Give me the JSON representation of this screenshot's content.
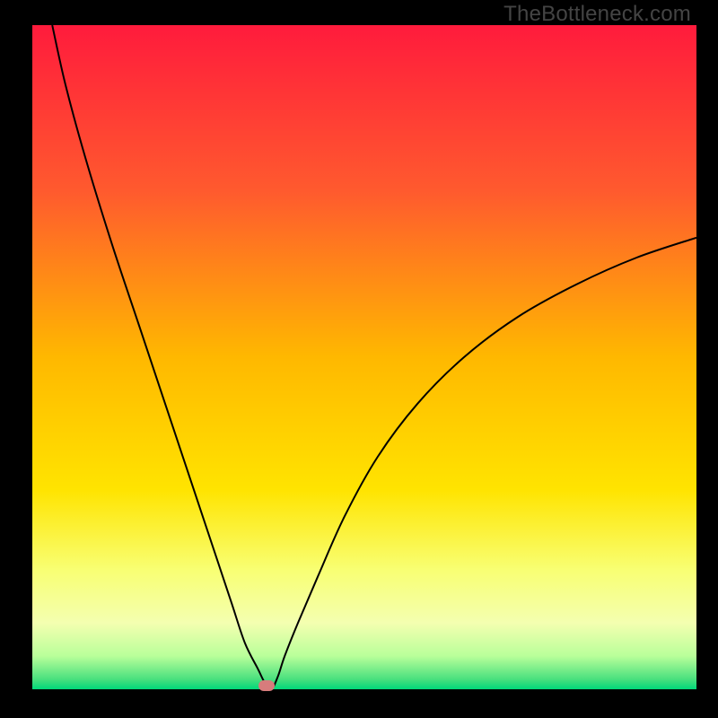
{
  "watermark": "TheBottleneck.com",
  "chart_data": {
    "type": "line",
    "title": "",
    "xlabel": "",
    "ylabel": "",
    "xlim": [
      0,
      100
    ],
    "ylim": [
      0,
      100
    ],
    "grid": false,
    "legend": false,
    "background_gradient": {
      "stops": [
        {
          "pos": 0.0,
          "color": "#ff1b3c"
        },
        {
          "pos": 0.25,
          "color": "#ff5a2e"
        },
        {
          "pos": 0.5,
          "color": "#ffb800"
        },
        {
          "pos": 0.7,
          "color": "#ffe400"
        },
        {
          "pos": 0.82,
          "color": "#f8ff73"
        },
        {
          "pos": 0.9,
          "color": "#f4ffb0"
        },
        {
          "pos": 0.95,
          "color": "#b9ff9a"
        },
        {
          "pos": 0.985,
          "color": "#49e07e"
        },
        {
          "pos": 1.0,
          "color": "#00d87a"
        }
      ]
    },
    "series": [
      {
        "name": "bottleneck-curve",
        "color": "#000000",
        "width": 2,
        "x": [
          3,
          5,
          8,
          12,
          16,
          20,
          24,
          27,
          30,
          32,
          34,
          35,
          36,
          37,
          38,
          40,
          43,
          47,
          52,
          58,
          65,
          73,
          82,
          91,
          100
        ],
        "y": [
          100,
          91,
          80,
          67,
          55,
          43,
          31,
          22,
          13,
          7,
          3,
          1,
          0,
          2,
          5,
          10,
          17,
          26,
          35,
          43,
          50,
          56,
          61,
          65,
          68
        ]
      }
    ],
    "marker": {
      "x": 35.3,
      "y": 0.5,
      "color": "#d77c7c"
    }
  }
}
